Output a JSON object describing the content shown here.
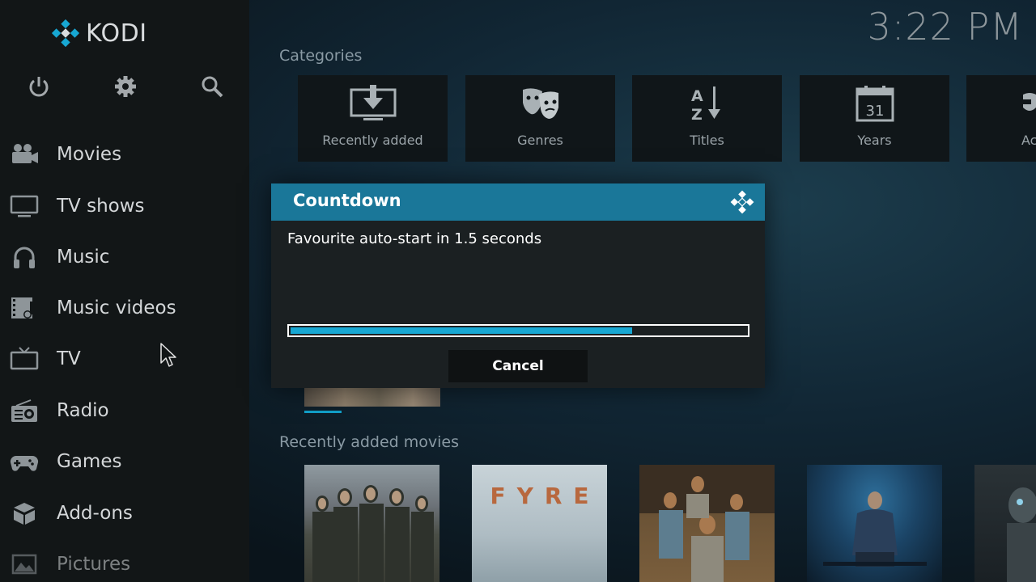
{
  "app": {
    "logo_text": "KODI",
    "clock": "3:22 PM"
  },
  "sidebar": {
    "top_icons": [
      "power-icon",
      "gear-icon",
      "search-icon"
    ],
    "items": [
      {
        "label": "Movies",
        "icon": "movie-camera-icon"
      },
      {
        "label": "TV shows",
        "icon": "monitor-icon"
      },
      {
        "label": "Music",
        "icon": "headphones-icon"
      },
      {
        "label": "Music videos",
        "icon": "film-music-icon"
      },
      {
        "label": "TV",
        "icon": "tv-icon"
      },
      {
        "label": "Radio",
        "icon": "radio-icon"
      },
      {
        "label": "Games",
        "icon": "gamepad-icon"
      },
      {
        "label": "Add-ons",
        "icon": "box-icon"
      },
      {
        "label": "Pictures",
        "icon": "picture-icon"
      }
    ]
  },
  "main": {
    "categories_title": "Categories",
    "categories": [
      {
        "label": "Recently added",
        "icon": "download-icon"
      },
      {
        "label": "Genres",
        "icon": "masks-icon"
      },
      {
        "label": "Titles",
        "icon": "a-z-icon"
      },
      {
        "label": "Years",
        "icon": "calendar-icon",
        "calendar_day": "31"
      },
      {
        "label": "Ac",
        "icon": "actors-icon"
      }
    ],
    "recent_title": "Recently added movies",
    "posters": [
      {
        "name": "poster-soldiers",
        "text": ""
      },
      {
        "name": "poster-fyre",
        "text": "FYRE"
      },
      {
        "name": "poster-family",
        "text": ""
      },
      {
        "name": "poster-man-seated",
        "text": ""
      },
      {
        "name": "poster-robot",
        "text": ""
      }
    ]
  },
  "dialog": {
    "title": "Countdown",
    "message": "Favourite auto-start in 1.5 seconds",
    "progress": 0.75,
    "cancel_label": "Cancel"
  },
  "colors": {
    "accent": "#17a7d3",
    "dialog_header": "#1a7799"
  }
}
